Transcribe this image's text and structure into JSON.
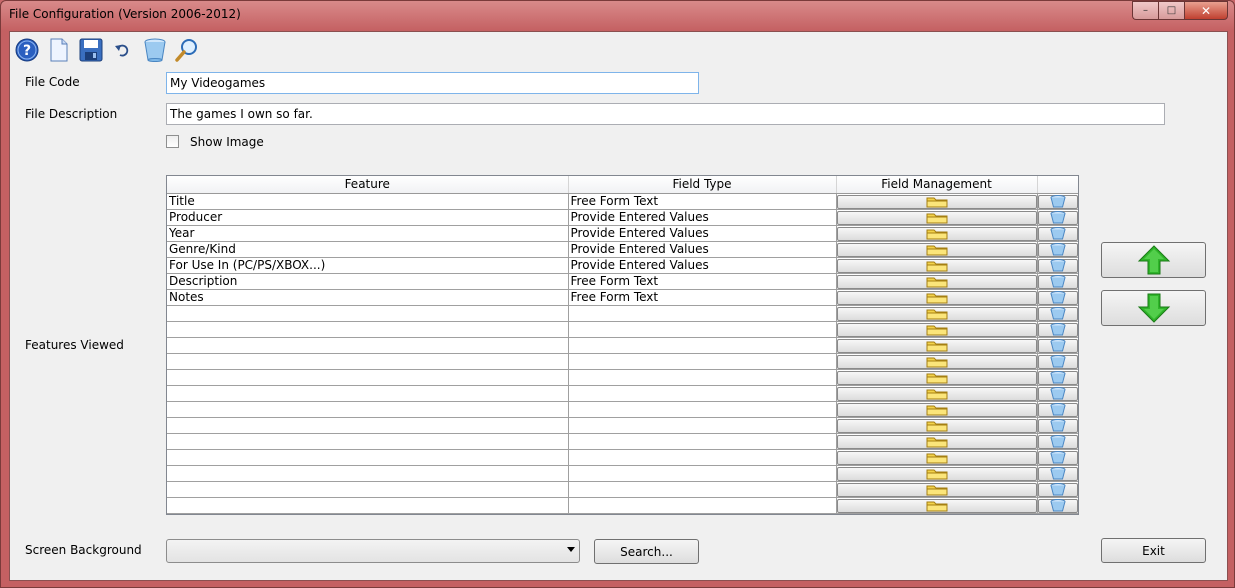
{
  "window": {
    "title": "File Configuration (Version 2006-2012)",
    "min_label": "–",
    "max_label": "□",
    "close_label": "✕"
  },
  "toolbar": {
    "items": [
      {
        "icon": "help-icon"
      },
      {
        "icon": "new-document-icon"
      },
      {
        "icon": "save-icon"
      },
      {
        "icon": "undo-icon"
      },
      {
        "icon": "delete-bucket-icon"
      },
      {
        "icon": "search-magnifier-icon"
      }
    ]
  },
  "form": {
    "file_code_label": "File Code",
    "file_code_value": "My Videogames",
    "file_description_label": "File Description",
    "file_description_value": "The games I own so far.",
    "show_image_label": "Show Image",
    "features_viewed_label": "Features Viewed",
    "screen_background_label": "Screen Background",
    "screen_background_value": ""
  },
  "grid": {
    "columns": [
      "Feature",
      "Field Type",
      "Field Management",
      ""
    ],
    "rows": [
      {
        "feature": "Title",
        "field_type": "Free Form Text"
      },
      {
        "feature": "Producer",
        "field_type": "Provide Entered Values"
      },
      {
        "feature": "Year",
        "field_type": "Provide Entered Values"
      },
      {
        "feature": "Genre/Kind",
        "field_type": "Provide Entered Values"
      },
      {
        "feature": "For Use In (PC/PS/XBOX...)",
        "field_type": "Provide Entered Values"
      },
      {
        "feature": "Description",
        "field_type": "Free Form Text"
      },
      {
        "feature": "Notes",
        "field_type": "Free Form Text"
      },
      {
        "feature": "",
        "field_type": ""
      },
      {
        "feature": "",
        "field_type": ""
      },
      {
        "feature": "",
        "field_type": ""
      },
      {
        "feature": "",
        "field_type": ""
      },
      {
        "feature": "",
        "field_type": ""
      },
      {
        "feature": "",
        "field_type": ""
      },
      {
        "feature": "",
        "field_type": ""
      },
      {
        "feature": "",
        "field_type": ""
      },
      {
        "feature": "",
        "field_type": ""
      },
      {
        "feature": "",
        "field_type": ""
      },
      {
        "feature": "",
        "field_type": ""
      },
      {
        "feature": "",
        "field_type": ""
      },
      {
        "feature": "",
        "field_type": ""
      }
    ]
  },
  "buttons": {
    "search_label": "Search...",
    "exit_label": "Exit"
  },
  "colors": {
    "arrow_green": "#2fb52a",
    "folder_yellow": "#f2d24a",
    "bucket_blue": "#7fb8e8",
    "help_blue": "#2a5fc0"
  }
}
